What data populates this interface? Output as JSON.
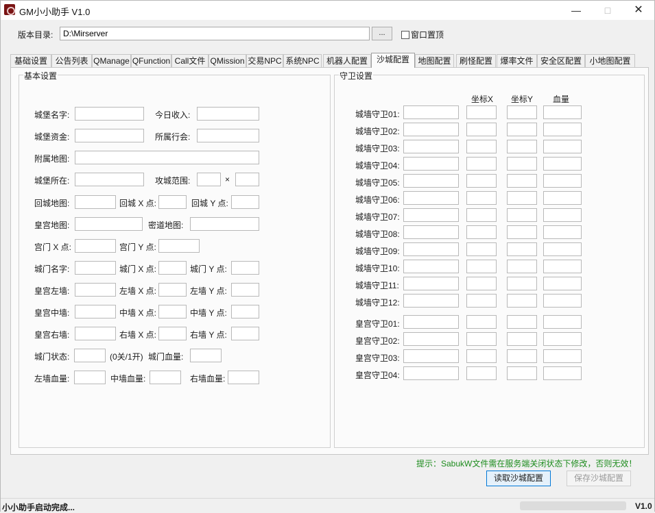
{
  "window": {
    "title": "GM小小助手 V1.0"
  },
  "toolbar": {
    "dir_label": "版本目录:",
    "dir_value": "D:\\Mirserver",
    "browse_label": "...",
    "ontop_label": "窗口置顶"
  },
  "tabs": [
    "基础设置",
    "公告列表",
    "QManage",
    "QFunction",
    "Call文件",
    "QMission",
    "交易NPC",
    "系统NPC",
    "机器人配置",
    "沙城配置",
    "地图配置",
    "刷怪配置",
    "爆率文件",
    "安全区配置",
    "小地图配置"
  ],
  "active_tab": "沙城配置",
  "basic": {
    "title": "基本设置",
    "castle_name": "城堡名字:",
    "today_income": "今日收入:",
    "castle_gold": "城堡资金:",
    "guild": "所属行会:",
    "attached_map": "附属地图:",
    "castle_location": "城堡所在:",
    "attack_range": "攻城范围:",
    "times": "×",
    "return_map": "回城地图:",
    "return_x": "回城 X 点:",
    "return_y": "回城 Y 点:",
    "palace_map": "皇宫地图:",
    "secret_map": "密道地图:",
    "palace_gate_x": "宫门 X 点:",
    "palace_gate_y": "宫门 Y 点:",
    "gate_name": "城门名字:",
    "gate_x": "城门 X 点:",
    "gate_y": "城门 Y 点:",
    "palace_left_wall": "皇宫左墙:",
    "left_wall_x": "左墙 X 点:",
    "left_wall_y": "左墙 Y 点:",
    "palace_mid_wall": "皇宫中墙:",
    "mid_wall_x": "中墙 X 点:",
    "mid_wall_y": "中墙 Y 点:",
    "palace_right_wall": "皇宫右墙:",
    "right_wall_x": "右墙 X 点:",
    "right_wall_y": "右墙 Y 点:",
    "gate_state": "城门状态:",
    "gate_state_hint": "(0关/1开)",
    "gate_hp": "城门血量:",
    "left_wall_hp": "左墙血量:",
    "mid_wall_hp": "中墙血量:",
    "right_wall_hp": "右墙血量:"
  },
  "guards": {
    "title": "守卫设置",
    "col_x": "坐标X",
    "col_y": "坐标Y",
    "col_hp": "血量",
    "wall_guards": [
      "城墙守卫01:",
      "城墙守卫02:",
      "城墙守卫03:",
      "城墙守卫04:",
      "城墙守卫05:",
      "城墙守卫06:",
      "城墙守卫07:",
      "城墙守卫08:",
      "城墙守卫09:",
      "城墙守卫10:",
      "城墙守卫11:",
      "城墙守卫12:"
    ],
    "palace_guards": [
      "皇宫守卫01:",
      "皇宫守卫02:",
      "皇宫守卫03:",
      "皇宫守卫04:"
    ]
  },
  "footer": {
    "hint": "提示：SabukW文件需在服务端关闭状态下修改，否则无效！",
    "load_button": "读取沙城配置",
    "save_button": "保存沙城配置"
  },
  "status": {
    "left": "小小助手启动完成...",
    "right": "V1.0"
  },
  "colors": {
    "hint": "#1d8c1d",
    "accent": "#0078d7"
  }
}
